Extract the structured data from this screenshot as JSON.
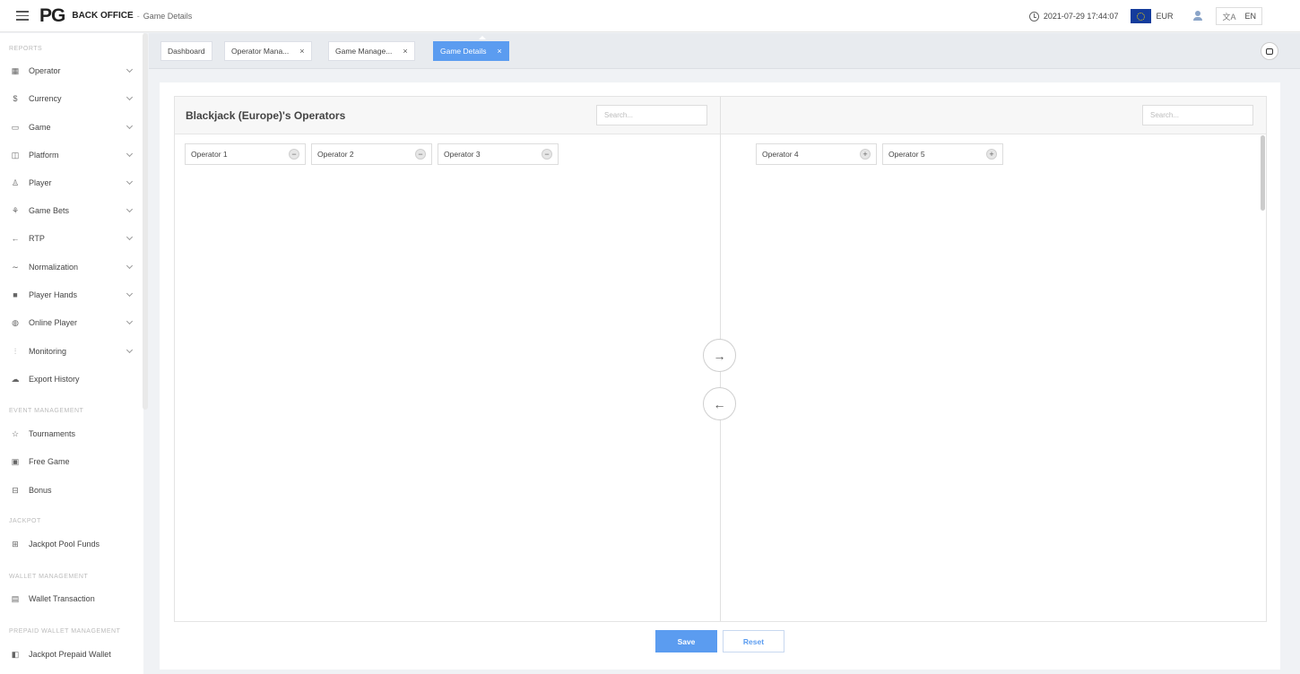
{
  "header": {
    "logo": "PG",
    "brand": "BACK OFFICE",
    "separator": "-",
    "breadcrumb": "Game Details",
    "datetime": "2021-07-29 17:44:07",
    "currency": "EUR",
    "language": "EN",
    "translate_icon": "文A"
  },
  "sidebar": {
    "sections": {
      "reports": "REPORTS",
      "event_management": "EVENT MANAGEMENT",
      "jackpot": "JACKPOT",
      "wallet_management": "WALLET MANAGEMENT",
      "prepaid_wallet_management": "PREPAID WALLET MANAGEMENT"
    },
    "items": [
      {
        "label": "Operator",
        "icon": "building-icon",
        "glyph": "▦"
      },
      {
        "label": "Currency",
        "icon": "dollar-icon",
        "glyph": "$"
      },
      {
        "label": "Game",
        "icon": "gamepad-icon",
        "glyph": "▭"
      },
      {
        "label": "Platform",
        "icon": "platform-icon",
        "glyph": "◫"
      },
      {
        "label": "Player",
        "icon": "person-icon",
        "glyph": "♙"
      },
      {
        "label": "Game Bets",
        "icon": "bets-icon",
        "glyph": "⚘"
      },
      {
        "label": "RTP",
        "icon": "rtp-arrow-icon",
        "glyph": "←"
      },
      {
        "label": "Normalization",
        "icon": "trend-icon",
        "glyph": "∼"
      },
      {
        "label": "Player Hands",
        "icon": "cards-icon",
        "glyph": "■"
      },
      {
        "label": "Online Player",
        "icon": "globe-icon",
        "glyph": "◍"
      },
      {
        "label": "Monitoring",
        "icon": "bar-chart-icon",
        "glyph": "⫶"
      },
      {
        "label": "Export History",
        "icon": "cloud-icon",
        "glyph": "☁"
      },
      {
        "label": "Tournaments",
        "icon": "star-icon",
        "glyph": "☆"
      },
      {
        "label": "Free Game",
        "icon": "monitor-icon",
        "glyph": "▣"
      },
      {
        "label": "Bonus",
        "icon": "gift-icon",
        "glyph": "⊟"
      },
      {
        "label": "Jackpot Pool Funds",
        "icon": "grid-icon",
        "glyph": "⊞"
      },
      {
        "label": "Wallet Transaction",
        "icon": "wallet-icon",
        "glyph": "▤"
      },
      {
        "label": "Jackpot Prepaid Wallet",
        "icon": "prepaid-icon",
        "glyph": "◧"
      }
    ]
  },
  "tabs": [
    {
      "label": "Dashboard"
    },
    {
      "label": "Operator Mana...",
      "close": "×"
    },
    {
      "label": "Game Manage...",
      "close": "×"
    },
    {
      "label": "Game Details",
      "close": "×"
    }
  ],
  "transfer": {
    "left_title": "Blackjack (Europe)'s Operators",
    "search_placeholder": "Search...",
    "left_items": [
      "Operator 1",
      "Operator 2",
      "Operator 3"
    ],
    "right_items": [
      "Operator 4",
      "Operator 5"
    ],
    "remove_glyph": "−",
    "add_glyph": "+",
    "move_right_glyph": "→",
    "move_left_glyph": "←"
  },
  "actions": {
    "save": "Save",
    "reset": "Reset"
  },
  "colors": {
    "accent": "#5b9cf0",
    "flag_blue": "#143c9c"
  }
}
